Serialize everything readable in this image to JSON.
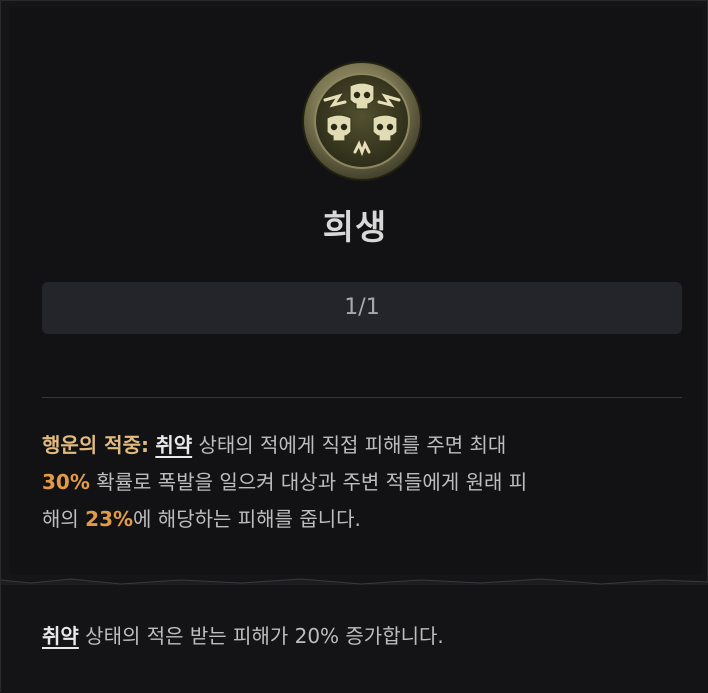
{
  "skill": {
    "icon": "skull-triad-medallion-icon",
    "title": "희생",
    "rank": "1/1"
  },
  "description": {
    "label": "행운의 적중:",
    "keyword": "취약",
    "line1_rest": " 상태의 적에게 직접 피해를 주면 최대",
    "chance": "30%",
    "line2_rest": " 확률로 폭발을 일으켜 대상과 주변 적들에게 원래 피",
    "line3_start": "해의 ",
    "percent": "23%",
    "line3_rest": "에 해당하는 피해를 줍니다."
  },
  "keyword_note": {
    "keyword": "취약",
    "text": " 상태의 적은 받는 피해가 20% 증가합니다."
  },
  "colors": {
    "background": "#151518",
    "lucky_hit_label": "#e3bb7e",
    "highlight_value": "#e39a44",
    "body_text": "#bdbdbd"
  }
}
